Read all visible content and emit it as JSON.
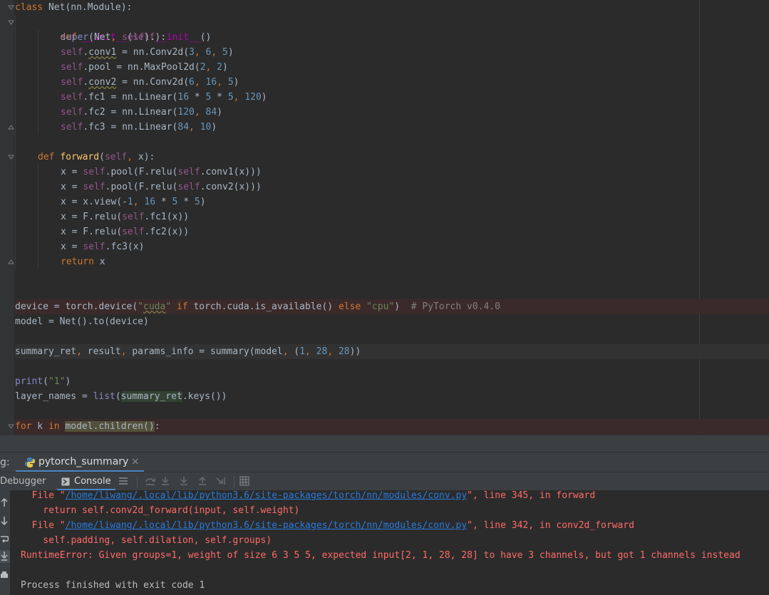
{
  "editor": {
    "lines": {
      "l1": "class Net(nn.Module):",
      "l2_def": "def ",
      "l2_name": "__init__",
      "l2_rest": "(self):",
      "l3": "super(Net, self).__init__()",
      "l4": "self.conv1 = nn.Conv2d(3, 6, 5)",
      "l5": "self.pool = nn.MaxPool2d(2, 2)",
      "l6": "self.conv2 = nn.Conv2d(6, 16, 5)",
      "l7": "self.fc1 = nn.Linear(16 * 5 * 5, 120)",
      "l8": "self.fc2 = nn.Linear(120, 84)",
      "l9": "self.fc3 = nn.Linear(84, 10)",
      "l11": "def forward(self, x):",
      "l12": "x = self.pool(F.relu(self.conv1(x)))",
      "l13": "x = self.pool(F.relu(self.conv2(x)))",
      "l14": "x = x.view(-1, 16 * 5 * 5)",
      "l15": "x = F.relu(self.fc1(x))",
      "l16": "x = F.relu(self.fc2(x))",
      "l17": "x = self.fc3(x)",
      "l18": "return x",
      "l21": "device = torch.device(\"cuda\" if torch.cuda.is_available() else \"cpu\")  # PyTorch v0.4.0",
      "l22": "model = Net().to(device)",
      "l24": "summary_ret, result, params_info = summary(model, (1, 28, 28))",
      "l26": "print(\"1\")",
      "l27": "layer_names = list(summary_ret.keys())",
      "l29": "for k in model.children():"
    }
  },
  "run_panel": {
    "prefix": "g:",
    "tab_label": "pytorch_summary",
    "close_glyph": "×",
    "debugger_label": "Debugger",
    "console_label": "Console"
  },
  "console": {
    "lines": [
      {
        "pre": "  File \"",
        "link": "/home/liwang/.local/lib/python3.6/site-packages/torch/nn/modules/conv.py",
        "post": "\", line 345, in forward"
      },
      {
        "text": "    return self.conv2d_forward(input, self.weight)"
      },
      {
        "pre": "  File \"",
        "link": "/home/liwang/.local/lib/python3.6/site-packages/torch/nn/modules/conv.py",
        "post": "\", line 342, in conv2d_forward"
      },
      {
        "text": "    self.padding, self.dilation, self.groups)"
      },
      {
        "text": "RuntimeError: Given groups=1, weight of size 6 3 5 5, expected input[2, 1, 28, 28] to have 3 channels, but got 1 channels instead"
      },
      {
        "text": ""
      },
      {
        "text": "Process finished with exit code 1"
      }
    ]
  },
  "colors": {
    "editor_bg": "#2b2b2b",
    "keyword": "#cc7832",
    "self": "#94558d",
    "number": "#6897bb",
    "string": "#6a8759",
    "comment": "#808080",
    "function": "#ffc66d",
    "error_text": "#ff6b68",
    "link": "#287bde",
    "tab_underline": "#4a88c7"
  }
}
